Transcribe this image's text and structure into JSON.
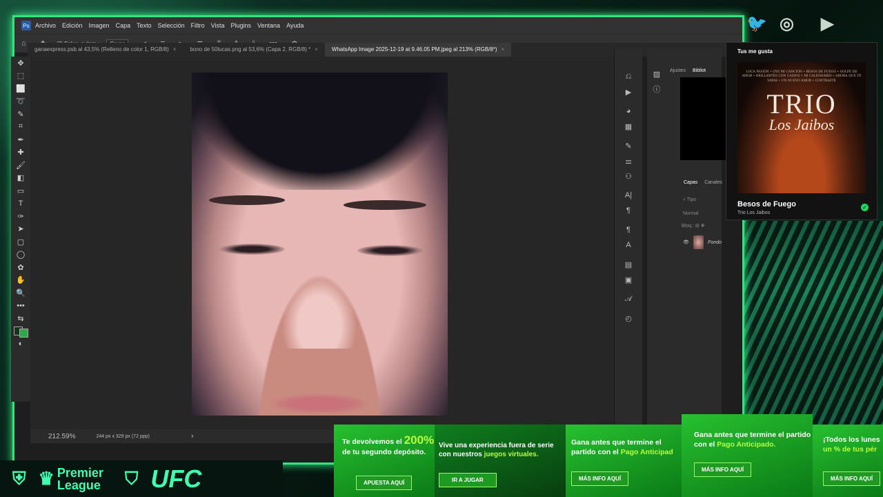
{
  "ps": {
    "logo": "Ps",
    "menu": [
      "Archivo",
      "Edición",
      "Imagen",
      "Capa",
      "Texto",
      "Selección",
      "Filtro",
      "Vista",
      "Plugins",
      "Ventana",
      "Ayuda"
    ],
    "options": {
      "auto_select": "Selec. autom.:",
      "group": "Grupo"
    },
    "tabs": [
      {
        "label": "ganaexpress.psb al 43,5% (Relleno de color 1, RGB/8)",
        "active": false
      },
      {
        "label": "bono de 50lucas.png al 53,6% (Capa 2, RGB/8) *",
        "active": false
      },
      {
        "label": "WhatsApp Image 2025-12-19 at 9.46.05 PM.jpeg al 213% (RGB/8*)",
        "active": true
      }
    ],
    "status": {
      "zoom": "212.59%",
      "size": "244 px x 329 px (72 ppp)",
      "arrow": "›"
    },
    "panel_tabs_top": [
      "Ajustes",
      "Bibliot"
    ],
    "panel_tabs_layers": [
      "Capas",
      "Canales"
    ],
    "layers_search_placeholder": "Tipo",
    "blend_mode": "Normal",
    "lock_label": "Bloq.:",
    "layer_name": "Fondo"
  },
  "spotify": {
    "header": "Tus me gusta",
    "album_tracks": "LOCA PASIÓN • OYE MI CANCIÓN • BESOS DE FUEGO • GOLPE DE AMOR • BRILLANTES CON CAIDOS • MI CALENDARIO • AHORA QUE TE VAYAS • UN NUEVO AMOR • CONTRASTE",
    "album_title_1": "TRIO",
    "album_title_2": "Los Jaibos",
    "song": "Besos de Fuego",
    "artist": "Trio Los Jaibos"
  },
  "logos": [
    "Premier League",
    "UFC"
  ],
  "banners": [
    {
      "text_a": "Te devolvemos el ",
      "highlight": "200%",
      "text_b": " de tu segundo depósito.",
      "button": "APUESTA AQUÍ"
    },
    {
      "text_a": "Vive una experiencia fuera de serie con nuestros ",
      "highlight": "juegos virtuales.",
      "text_b": "",
      "button": "IR A JUGAR"
    },
    {
      "text_a": "Gana antes que termine el partido con el ",
      "highlight": "Pago Anticipad",
      "text_b": "",
      "button": "MÁS INFO AQUÍ"
    },
    {
      "text_a": "Gana antes que termine el partido con el ",
      "highlight": "Pago Anticipado.",
      "text_b": "",
      "button": "MÁS INFO AQUÍ"
    },
    {
      "text_a": "¡Todos los lunes ",
      "highlight": "un % de tus pér",
      "text_b": "",
      "button": "MÁS INFO AQUÍ"
    }
  ]
}
